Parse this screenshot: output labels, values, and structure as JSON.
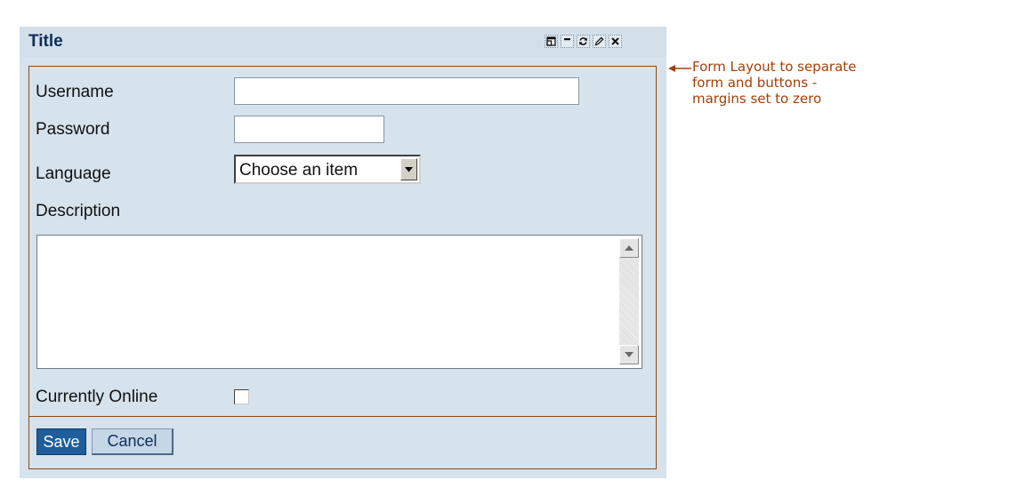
{
  "panel": {
    "title": "Title",
    "toolbar_icons": [
      "restore-icon",
      "minimize-icon",
      "refresh-icon",
      "edit-icon",
      "close-icon"
    ]
  },
  "form": {
    "username": {
      "label": "Username",
      "value": ""
    },
    "password": {
      "label": "Password",
      "value": ""
    },
    "language": {
      "label": "Language",
      "selected": "Choose an item"
    },
    "description": {
      "label": "Description",
      "value": ""
    },
    "online": {
      "label": "Currently Online",
      "checked": false
    }
  },
  "buttons": {
    "save": "Save",
    "cancel": "Cancel"
  },
  "annotation": {
    "lines": [
      "Form Layout to separate",
      "form and buttons -",
      "margins set to zero"
    ]
  },
  "colors": {
    "panel_bg": "#d6e2ec",
    "title_text": "#0e2f5a",
    "layout_border": "#8b4a16",
    "annotation_text": "#a0400a",
    "save_bg": "#1f5e9a",
    "cancel_bg": "#c5d6e6"
  }
}
